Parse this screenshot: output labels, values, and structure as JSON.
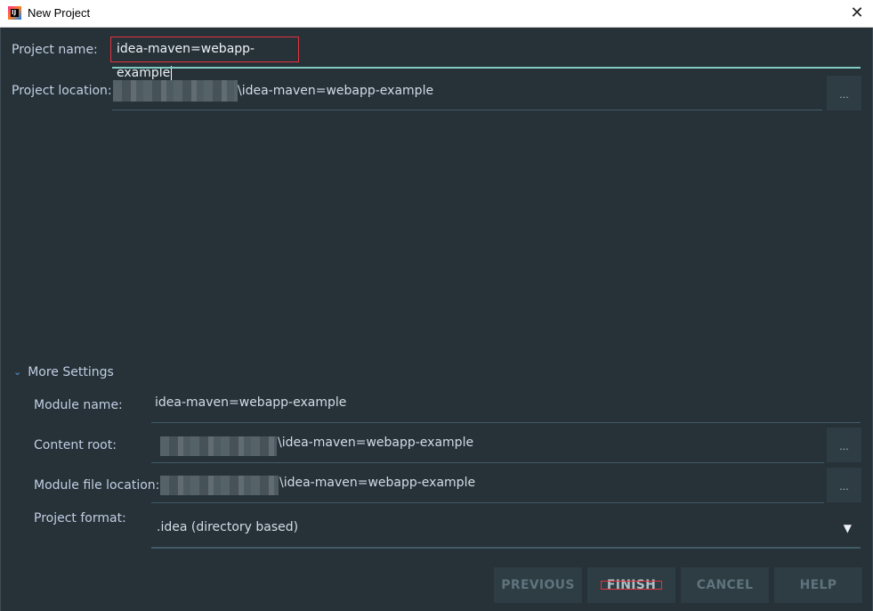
{
  "window": {
    "title": "New Project",
    "close_glyph": "✕",
    "app_icon": "intellij-icon"
  },
  "project_name": {
    "label": "Project name:",
    "value": "idea-maven=webapp-example"
  },
  "project_location": {
    "label": "Project location:",
    "value_suffix": "\\idea-maven=webapp-example",
    "browse_label": "..."
  },
  "more_settings": {
    "label": "More Settings",
    "expanded": true
  },
  "module_name": {
    "label": "Module name:",
    "value": "idea-maven=webapp-example"
  },
  "content_root": {
    "label": "Content root:",
    "value_suffix": "\\idea-maven=webapp-example",
    "browse_label": "..."
  },
  "module_file_location": {
    "label": "Module file location:",
    "value_suffix": "\\idea-maven=webapp-example",
    "browse_label": "..."
  },
  "project_format": {
    "label": "Project format:",
    "value": ".idea (directory based)"
  },
  "buttons": {
    "previous": "PREVIOUS",
    "finish": "FINISH",
    "cancel": "CANCEL",
    "help": "HELP"
  },
  "colors": {
    "background": "#263238",
    "accent": "#80cbc4",
    "highlight_border": "#e0343f"
  }
}
